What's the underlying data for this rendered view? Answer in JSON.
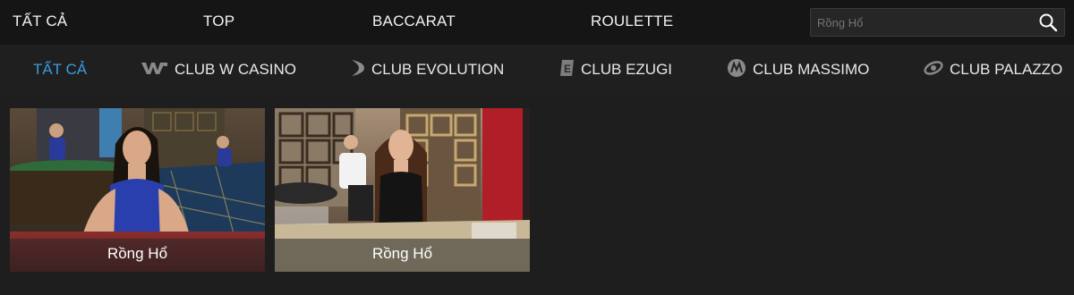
{
  "top_nav": [
    "TẤT CẢ",
    "TOP",
    "BACCARAT",
    "ROULETTE"
  ],
  "search": {
    "placeholder": "Rồng Hổ",
    "icon": "search-icon"
  },
  "club_nav": [
    {
      "label": "TẤT CẢ",
      "icon": "grid-icon",
      "active": true
    },
    {
      "label": "CLUB W CASINO",
      "icon": "w-casino-logo-icon",
      "active": false
    },
    {
      "label": "CLUB EVOLUTION",
      "icon": "evolution-logo-icon",
      "active": false
    },
    {
      "label": "CLUB EZUGI",
      "icon": "ezugi-logo-icon",
      "active": false
    },
    {
      "label": "CLUB MASSIMO",
      "icon": "massimo-logo-icon",
      "active": false
    },
    {
      "label": "CLUB PALAZZO",
      "icon": "palazzo-logo-icon",
      "active": false
    }
  ],
  "games": [
    {
      "title": "Rồng Hổ"
    },
    {
      "title": "Rồng Hổ"
    }
  ],
  "colors": {
    "accent": "#3b9be0",
    "background": "#1e1e1e",
    "topbar": "#151515"
  }
}
